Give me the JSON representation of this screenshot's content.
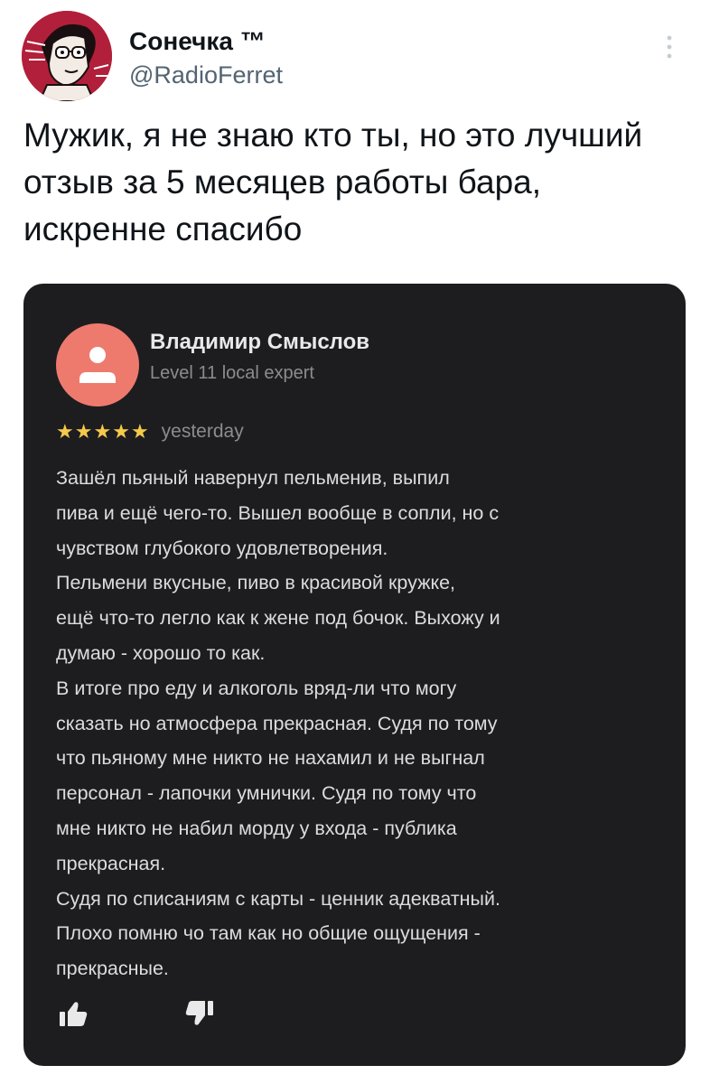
{
  "tweet": {
    "author_name": "Сонечка ™",
    "author_handle": "@RadioFerret",
    "text_lines": [
      "Мужик, я не знаю кто ты, но это лучший",
      "отзыв за 5 месяцев работы бара,",
      "искренне спасибо"
    ]
  },
  "review": {
    "reviewer_name": "Владимир Смыслов",
    "reviewer_level": "Level 11 local expert",
    "rating": 5,
    "rating_max": 5,
    "date": "yesterday",
    "body_lines": [
      "Зашёл пьяный навернул пельменив, выпил",
      "пива и ещё чего-то. Вышел вообще в сопли, но с",
      "чувством глубокого удовлетворения.",
      "Пельмени вкусные, пиво в красивой кружке,",
      "ещё что-то легло как к жене под бочок. Выхожу и",
      "думаю - хорошо то как.",
      "В итоге про еду и алкоголь вряд-ли что могу",
      "сказать но атмосфера прекрасная. Судя по тому",
      "что пьяному мне никто не нахамил и не выгнал",
      "персонал - лапочки умнички. Судя по тому что",
      "мне никто не набил морду у входа - публика",
      "прекрасная.",
      "Судя по списаниям с карты - ценник адекватный.",
      "Плохо помню чо там как но общие ощущения -",
      "прекрасные."
    ]
  },
  "icons": {
    "more": "more-vertical-icon",
    "like": "thumbs-up-icon",
    "dislike": "thumbs-down-icon",
    "reviewer_avatar": "user-icon",
    "star": "star-icon"
  },
  "colors": {
    "card_background": "#1d1d20",
    "reviewer_avatar": "#ee7a6e",
    "star": "#f5c94a",
    "tweet_avatar": "#b21f3a"
  }
}
